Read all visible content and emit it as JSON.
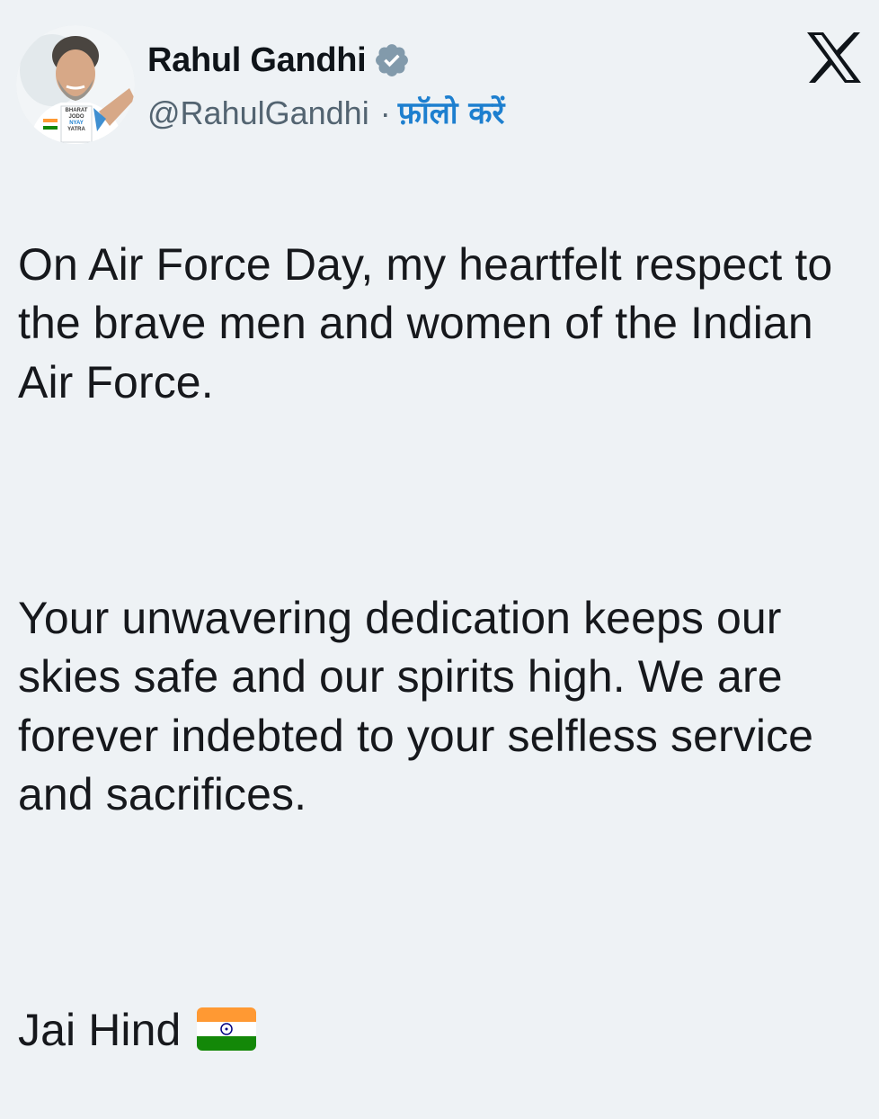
{
  "user": {
    "display_name": "Rahul Gandhi",
    "handle": "@RahulGandhi",
    "separator": "·",
    "follow_label": "फ़ॉलो करें",
    "avatar_text": [
      "BHARAT",
      "JODO",
      "NYAY",
      "YATRA"
    ],
    "verified_badge_color": "#829aab"
  },
  "platform": {
    "logo_icon": "x-logo-icon"
  },
  "tweet": {
    "paragraph1": "On Air Force Day, my heartfelt respect to the brave men and women of the Indian Air Force.",
    "paragraph2": "Your unwavering dedication keeps our skies safe and our spirits high. We are forever indebted to your selfless service and sacrifices.",
    "paragraph3": "Jai Hind",
    "emoji": "indian-flag-icon"
  },
  "colors": {
    "background": "#eef2f5",
    "text": "#0f1419",
    "secondary": "#536471",
    "link": "#1d7fcf",
    "saffron": "#ff9933",
    "green": "#138808",
    "chakra": "#000080"
  }
}
